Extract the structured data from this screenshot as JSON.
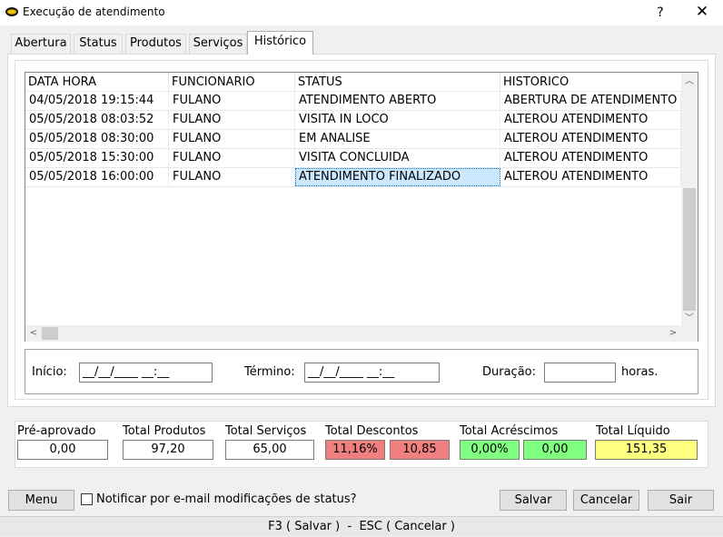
{
  "window": {
    "title": "Execução de atendimento",
    "help_label": "?",
    "close_label": "✕"
  },
  "tabs": [
    {
      "label": "Abertura"
    },
    {
      "label": "Status"
    },
    {
      "label": "Produtos"
    },
    {
      "label": "Serviços"
    },
    {
      "label": "Histórico",
      "active": true
    }
  ],
  "grid": {
    "columns": [
      "DATA HORA",
      "FUNCIONARIO",
      "STATUS",
      "HISTORICO"
    ],
    "rows": [
      [
        "04/05/2018 19:15:44",
        "FULANO",
        "ATENDIMENTO ABERTO",
        "ABERTURA DE ATENDIMENTO"
      ],
      [
        "05/05/2018 08:03:52",
        "FULANO",
        "VISITA IN LOCO",
        "ALTEROU ATENDIMENTO"
      ],
      [
        "05/05/2018 08:30:00",
        "FULANO",
        "EM ANALISE",
        "ALTEROU ATENDIMENTO"
      ],
      [
        "05/05/2018 15:30:00",
        "FULANO",
        "VISITA CONCLUIDA",
        "ALTEROU ATENDIMENTO"
      ],
      [
        "05/05/2018 16:00:00",
        "FULANO",
        "ATENDIMENTO FINALIZADO",
        "ALTEROU ATENDIMENTO"
      ]
    ],
    "selected_row": 4,
    "selected_col": 2
  },
  "time": {
    "inicio_label": "Início:",
    "inicio_value": "__/__/____ __:__",
    "termino_label": "Término:",
    "termino_value": "__/__/____ __:__",
    "duracao_label": "Duração:",
    "duracao_value": "",
    "horas_label": "horas."
  },
  "totals": {
    "pre_aprovado_label": "Pré-aprovado",
    "pre_aprovado_value": "0,00",
    "produtos_label": "Total Produtos",
    "produtos_value": "97,20",
    "servicos_label": "Total Serviços",
    "servicos_value": "65,00",
    "descontos_label": "Total Descontos",
    "descontos_percent": "11,16%",
    "descontos_value": "10,85",
    "acrescimos_label": "Total Acréscimos",
    "acrescimos_percent": "0,00%",
    "acrescimos_value": "0,00",
    "liquido_label": "Total Líquido",
    "liquido_value": "151,35"
  },
  "colors": {
    "descontos_bg": "#f08080",
    "acrescimos_bg": "#80ff80",
    "liquido_bg": "#ffff80",
    "selection_bg": "#cce8ff"
  },
  "bottom": {
    "menu_label": "Menu",
    "notify_label": "Notificar por e-mail modificações de status?",
    "save_label": "Salvar",
    "cancel_label": "Cancelar",
    "exit_label": "Sair"
  },
  "footer": {
    "hint": "F3 ( Salvar )  -  ESC ( Cancelar )"
  }
}
